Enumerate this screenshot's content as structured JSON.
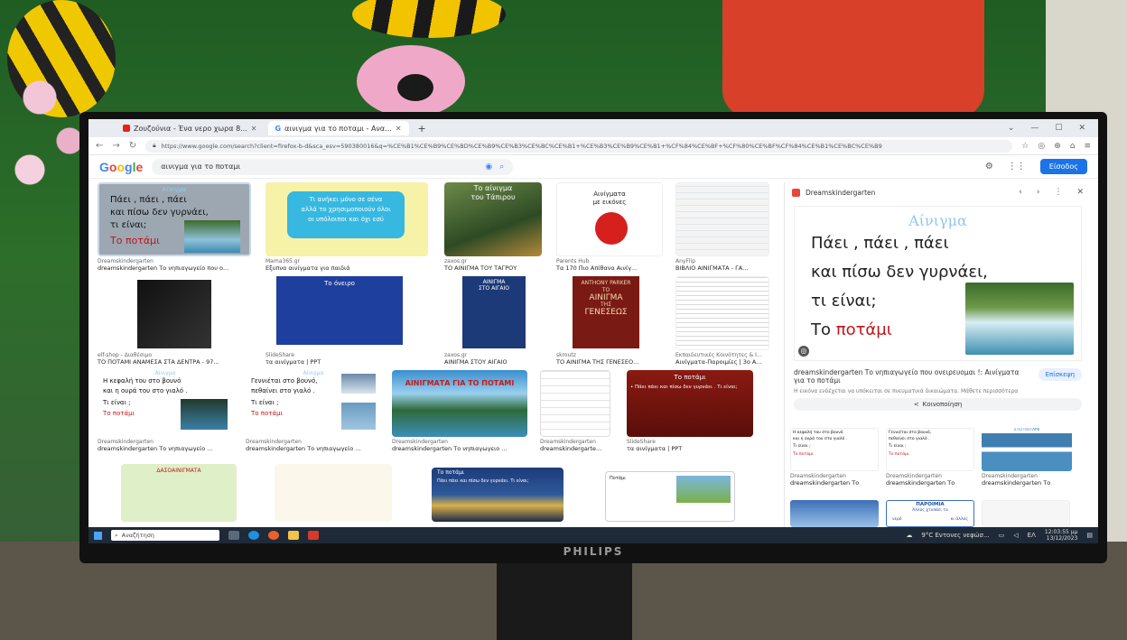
{
  "browser": {
    "tabs": [
      {
        "label": "Ζουζούνια - Ένα νερο χωρα 8...",
        "active": false
      },
      {
        "label": "αινιγμα για το ποταμι - Ανα...",
        "active": true
      }
    ],
    "new_tab": "+",
    "url": "https://www.google.com/search?client=firefox-b-d&sca_esv=590380016&q=%CE%B1%CE%B9%CE%BD%CE%B9%CE%B3%CE%BC%CE%B1+%CE%B3%CE%B9%CE%B1+%CF%84%CE%BF+%CF%80%CE%BF%CF%84%CE%B1%CE%BC%CE%B9"
  },
  "google": {
    "logo": "Google",
    "query": "αινιγμα για το ποταμι",
    "signin_label": "Είσοδος"
  },
  "results": [
    {
      "source": "Dreamskindergarten",
      "title": "dreamskindergarten Το νηπιαγωγείο που ο...",
      "thumb_text": [
        "Αίνιγμα",
        "Πάει , πάει , πάει",
        "και πίσω δεν γυρνάει,",
        "τι είναι;",
        "Το ποτάμι"
      ]
    },
    {
      "source": "Mama365.gr",
      "title": "Εξυπνα αινίγματα για παιδιά",
      "thumb_text": [
        "Τι ανήκει μόνο σε σένα",
        "αλλά το χρησιμοποιούν όλοι",
        "οι υπόλοιποι και όχι εσύ"
      ]
    },
    {
      "source": "zaxos.gr",
      "title": "ΤΟ ΑΙΝΙΓΜΑ ΤΟΥ ΤΑΓΡΟΥ",
      "thumb_text": [
        "Το αίνιγμα",
        "του Τάπιρου"
      ]
    },
    {
      "source": "Parents Hub",
      "title": "Τα 170 Πιο Απίθανα Αινίγ...",
      "thumb_text": [
        "Αινίγματα",
        "με εικόνες"
      ]
    },
    {
      "source": "AnyFlip",
      "title": "ΒΙΒΛΙΟ ΑΙΝΙΓΜΑΤΑ - ΓΑ...",
      "thumb_text": []
    },
    {
      "source": "elf-shop - Διαθέσιμο",
      "title": "ΤΟ ΠΟΤΑΜΙ ΑΝΑΜΕΣΑ ΣΤΑ ΔΕΝΤΡΑ - 97...",
      "thumb_text": []
    },
    {
      "source": "SlideShare",
      "title": "τα αινίγματα | PPT",
      "thumb_text": [
        "Το όνειρο"
      ]
    },
    {
      "source": "zaxos.gr",
      "title": "ΑΙΝΙΓΜΑ ΣΤΟΥ ΑΙΓΑΙΟ",
      "thumb_text": [
        "ΑΙΝΙΓΜΑ",
        "ΣΤΟ ΑΙΓΑΙΟ"
      ]
    },
    {
      "source": "skroutz",
      "title": "ΤΟ ΑΙΝΙΓΜΑ ΤΗΣ ΓΕΝΕΣΕΟ...",
      "thumb_text": [
        "ANTHONY PARKER",
        "ΤΟ",
        "ΑΙΝΙΓΜΑ",
        "ΤΗΣ",
        "ΓΕΝΕΣΕΩΣ"
      ]
    },
    {
      "source": "Εκπαιδευτικές Κοινότητες & Ι...",
      "title": "Αινίγματα-Παροιμίες | 3ο Α...",
      "thumb_text": []
    },
    {
      "source": "Dreamskindergarten",
      "title": "dreamskindergarten Το νηπιαγωγείο ...",
      "thumb_text": [
        "Αίνιγμα",
        "Η κεφαλή του στο βουνό",
        "και η ουρά του στο γιαλό .",
        "Τι είναι ;",
        "Το ποτάμι"
      ]
    },
    {
      "source": "Dreamskindergarten",
      "title": "dreamskindergarten Το νηπιαγωγείο ...",
      "thumb_text": [
        "Αίνιγμα",
        "Γεννιέται στο βουνό,",
        "πεθαίνει στο γιαλό .",
        "Τι είναι ;",
        "Το ποτάμι"
      ]
    },
    {
      "source": "Dreamskindergarten",
      "title": "dreamskindergarten Το νηπιαγωγειο ...",
      "thumb_text": [
        "ΑΙΝΙΓΜΑΤΑ ΓΙΑ ΤΟ ΠΟΤΑΜΙ"
      ]
    },
    {
      "source": "Dreamskindergarten",
      "title": "dreamskindergarte...",
      "thumb_text": []
    },
    {
      "source": "SlideShare",
      "title": "τα αινίγματα | PPT",
      "thumb_text": [
        "Το ποτάμι",
        "• Πάει πάει και πίσω δεν γυρνάει . Τι είναι;"
      ]
    },
    {
      "source": "",
      "title": "",
      "thumb_text": [
        "ΔΑΣΟΑΙΝΙΓΜΑΤΑ"
      ]
    },
    {
      "source": "",
      "title": "",
      "thumb_text": []
    },
    {
      "source": "",
      "title": "",
      "thumb_text": [
        "Το ποτάμι",
        "Πάει πάει και πίσω δεν γυρνάει. Τι είναι;"
      ]
    },
    {
      "source": "",
      "title": "",
      "thumb_text": [
        "Ποτάμι"
      ]
    }
  ],
  "panel": {
    "site": "Dreamskindergarten",
    "riddle_title": "Αίνιγμα",
    "lines": [
      "Πάει , πάει , πάει",
      "και πίσω δεν γυρνάει,",
      "τι είναι;"
    ],
    "answer_prefix": "Το ",
    "answer": "ποτάμι",
    "description": "dreamskindergarten Το νηπιαγωγείο που ονειρευομαι !: Αινίγματα για το ποτάμι",
    "visit_label": "Επίσκεψη",
    "sub_text": "Η εικόνα ενδέχεται να υπόκειται σε πνευματικά δικαιώματα. Μάθετε περισσότερα",
    "share_label": "Κοινοποίηση",
    "related": [
      {
        "source": "Dreamskindergarten",
        "title": "dreamskindergarten Το",
        "thumb_text": [
          "Η κεφαλή του στο βουνό",
          "και η ουρά του στο γιαλό .",
          "Τι είναι ;",
          "Το ποτάμι"
        ]
      },
      {
        "source": "Dreamskindergarten",
        "title": "dreamskindergarten Το",
        "thumb_text": [
          "Γεννιέται στο βουνό,",
          "πεθαίνει στο γιαλό .",
          "Τι είναι ;",
          "Το ποτάμι"
        ]
      },
      {
        "source": "Dreamskindergarten",
        "title": "dreamskindergarten Το",
        "thumb_text": [
          "ΣΤΟ ΠΟΤΑΜΙ"
        ]
      },
      {
        "source": "",
        "title": "",
        "thumb_text": [
          "ΠΑΡΟΙΜΙΑ",
          "Άλλος χτυπάει το",
          "νερό",
          "κι άλλος"
        ]
      }
    ]
  },
  "taskbar": {
    "search_placeholder": "Αναζήτηση",
    "weather": "9°C Εντονες νεφώσ...",
    "lang": "ΕΛ",
    "time": "12:03:55 μμ",
    "date": "13/12/2023"
  },
  "monitor_brand": "PHILIPS"
}
